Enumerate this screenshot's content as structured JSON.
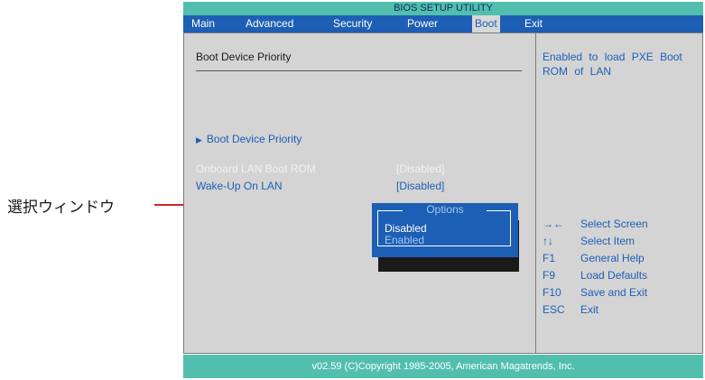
{
  "annotation": {
    "label": "選択ウィンドウ",
    "color": "#d0262b"
  },
  "title": "BIOS SETUP UTILITY",
  "menu": [
    {
      "label": "Main"
    },
    {
      "label": "Advanced"
    },
    {
      "label": "Security"
    },
    {
      "label": "Power"
    },
    {
      "label": "Boot",
      "active": true
    },
    {
      "label": "Exit"
    }
  ],
  "main": {
    "section_title": "Boot Device Priority",
    "submenu_link": "Boot Device Priority",
    "settings": [
      {
        "label": "Onboard LAN Boot ROM",
        "value": "[Disabled]",
        "highlighted": false
      },
      {
        "label": "Wake-Up On LAN",
        "value": "[Disabled]",
        "highlighted": true
      }
    ]
  },
  "popup": {
    "title": "Options",
    "options": [
      {
        "label": "Disabled",
        "selected": true
      },
      {
        "label": "Enabled",
        "selected": false
      }
    ]
  },
  "help": {
    "description": "Enabled to load PXE Boot ROM of LAN",
    "keys": [
      {
        "key": "→←",
        "icon": "left-right-arrows-icon",
        "action": "Select Screen"
      },
      {
        "key": "↑↓",
        "icon": "up-down-arrows-icon",
        "action": "Select Item"
      },
      {
        "key": "F1",
        "action": "General Help"
      },
      {
        "key": "F9",
        "action": "Load Defaults"
      },
      {
        "key": "F10",
        "action": "Save and Exit"
      },
      {
        "key": "ESC",
        "action": "Exit"
      }
    ]
  },
  "footer": "v02.59 (C)Copyright 1985-2005, American Magatrends, Inc.",
  "colors": {
    "accent": "#1d5fb4",
    "teal": "#52bfae",
    "panel": "#d4d4d4"
  }
}
